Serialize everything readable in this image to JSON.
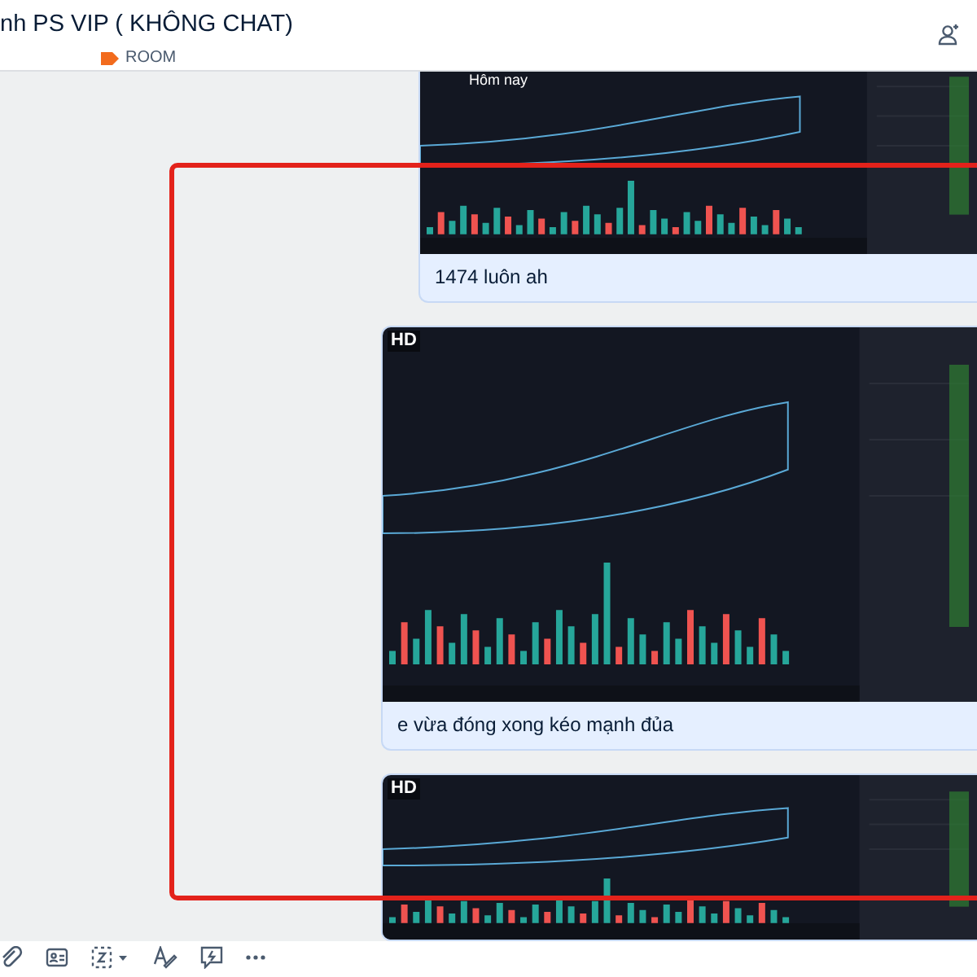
{
  "header": {
    "title": "nh PS VIP ( KHÔNG CHAT)",
    "tag": "ROOM"
  },
  "messages": [
    {
      "kind": "picture",
      "overlay_text": "Hôm nay",
      "caption": "1474 luôn ah"
    },
    {
      "kind": "picture",
      "badge": "HD",
      "caption": "e vừa đóng xong kéo mạnh đủa"
    },
    {
      "kind": "picture",
      "badge": "HD"
    }
  ],
  "highlight": {
    "visible": true
  }
}
